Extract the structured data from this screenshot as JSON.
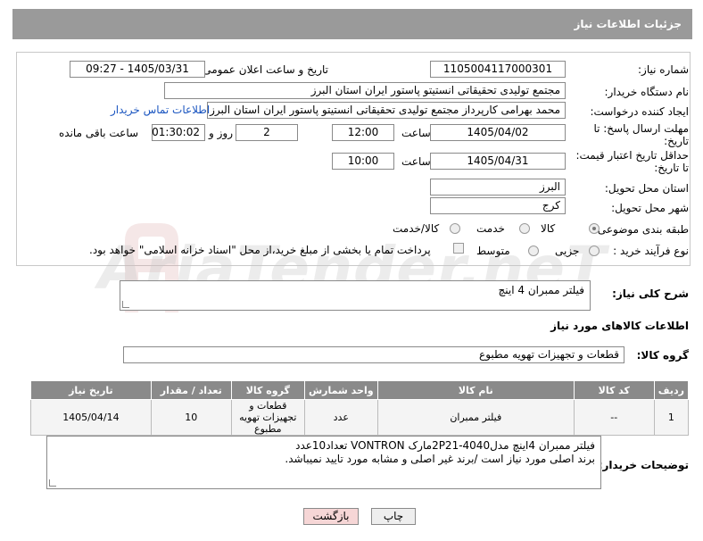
{
  "header": {
    "title": "جزئیات اطلاعات نیاز"
  },
  "form": {
    "need_number_label": "شماره نیاز:",
    "need_number": "1105004117000301",
    "announce_label": "تاریخ و ساعت اعلان عمومی:",
    "announce_value": "1405/03/31 - 09:27",
    "buyer_org_label": "نام دستگاه خریدار:",
    "buyer_org": "مجتمع تولیدی تحقیقاتی انستیتو پاستور ایران استان البرز",
    "requester_label": "ایجاد کننده درخواست:",
    "requester": "محمد بهرامی کارپرداز مجتمع تولیدی تحقیقاتی انستیتو پاستور ایران استان البرز",
    "buyer_contact_link": "اطلاعات تماس خریدار",
    "deadline_label": "مهلت ارسال پاسخ: تا تاریخ:",
    "deadline_date": "1405/04/02",
    "time_label": "ساعت",
    "deadline_time": "12:00",
    "days_value": "2",
    "days_label": "روز و",
    "remaining_time": "01:30:02",
    "remaining_label": "ساعت باقی مانده",
    "price_validity_label": "حداقل تاریخ اعتبار قیمت: تا تاریخ:",
    "price_validity_date": "1405/04/31",
    "price_validity_time": "10:00",
    "province_label": "استان محل تحویل:",
    "province": "البرز",
    "city_label": "شهر محل تحویل:",
    "city": "کرج",
    "category_label": "طبقه بندی موضوعی:",
    "category_options": [
      "کالا",
      "خدمت",
      "کالا/خدمت"
    ],
    "purchase_type_label": "نوع فرآیند خرید :",
    "purchase_options": [
      "جزیی",
      "متوسط"
    ],
    "payment_note": "پرداخت تمام یا بخشی از مبلغ خرید،از محل \"اسناد خزانه اسلامی\" خواهد بود."
  },
  "description": {
    "label": "شرح کلی نیاز:",
    "value": "فیلتر ممبران 4 اینچ"
  },
  "goods_info": {
    "title": "اطلاعات کالاهای مورد نیاز",
    "group_label": "گروه کالا:",
    "group_value": "قطعات و تجهیزات تهویه مطبوع"
  },
  "table": {
    "headers": [
      "ردیف",
      "کد کالا",
      "نام کالا",
      "واحد شمارش",
      "گروه کالا",
      "تعداد / مقدار",
      "تاریخ نیاز"
    ],
    "rows": [
      {
        "row": "1",
        "code": "--",
        "name": "فیلتر ممبران",
        "unit": "عدد",
        "group": "قطعات و تجهیزات تهویه مطبوع",
        "qty": "10",
        "date": "1405/04/14"
      }
    ]
  },
  "buyer_notes": {
    "label": "توضیحات خریدار:",
    "line1": "فیلتر ممبران 4اینچ مدل2P21-4040مارک VONTRON تعداد10عدد",
    "line2": "برند اصلی مورد نیاز است /برند غیر اصلی و مشابه مورد تایید نمیباشد."
  },
  "buttons": {
    "print": "چاپ",
    "back": "بازگشت"
  },
  "watermark": "AriaTender.neT",
  "colors": {
    "header_bg": "#9a9a9a",
    "link": "#1a55c0",
    "back_btn_bg": "#f6d6d6",
    "print_btn_bg": "#eeeeee"
  }
}
